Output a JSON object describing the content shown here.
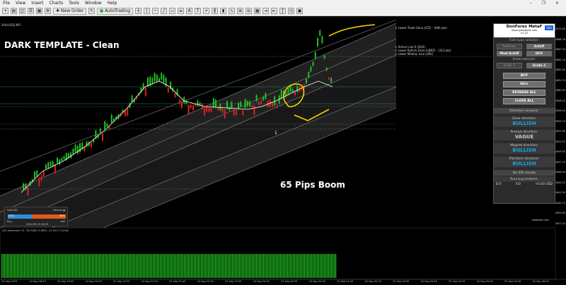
{
  "menu": [
    "File",
    "View",
    "Insert",
    "Charts",
    "Tools",
    "Window",
    "Help"
  ],
  "toolbar": {
    "new_order": "New Order",
    "autotrading": "AutoTrading"
  },
  "chart": {
    "symbol": "XAUUSD,M5",
    "title": "DARK TEMPLATE  - Clean",
    "annotation": "65 Pips Boom",
    "signal_label": "1",
    "watermark": "Doaks09.com"
  },
  "legend": [
    "< Lower Trade Zone (LTZ) - (846 pts)",
    "< Active Line 0 (ALD)",
    "< Lower Bullish Zone (LBBZ) - (313 pts)",
    "< Lower Median Line (LML)"
  ],
  "panel": {
    "brand": "DonForex MetaF",
    "url": "https://donforex.com",
    "version": "v1.22",
    "info": "Info",
    "fork_type_label": "Fork type selector:",
    "fork_types": [
      "Andrews",
      "Schiff",
      "Mod-Schiff",
      "DFX"
    ],
    "scale_label": "Scale selector:",
    "scales": [
      "Scale 1",
      "Scale 2"
    ],
    "actions": [
      "BUY",
      "SELL",
      "REVERSE ALL",
      "CLOSE ALL"
    ],
    "direction_title": "Direction analysis:",
    "zone_label": "Zone direction:",
    "zone_value": "BULLISH",
    "prompt_label": "Prompt direction:",
    "prompt_value": "VAGUE",
    "magnet_label": "Magnet direction:",
    "magnet_value": "BULLISH",
    "pitchfork_label": "Pitchfork direction:",
    "pitchfork_value": "BULLISH",
    "nearby": "No S/R nearby",
    "running_label": "Running trade(s):",
    "trade_b": "B:0",
    "trade_s": "S:0",
    "trade_pl": "+0.00 USD"
  },
  "mini_widget": {
    "symbol": "XAUUSD",
    "neutral": "Neutral ◆",
    "buy_pct": "42%",
    "sell_pct": "58%",
    "buy": "Buy",
    "sell": "Sell",
    "date": "2024.09.25 06:55"
  },
  "sentiment_label": "ATS Sentiment V2 -76.0168 23.9892 -52.0217 0.0000",
  "price_scale": [
    "2670.50",
    "2668.76",
    "2667.04",
    "2665.24",
    "2663.49",
    "2661.74",
    "2660.00",
    "2658.25",
    "2656.50",
    "2654.74",
    "2652.99",
    "2651.25",
    "2649.50",
    "2647.75",
    "2646.00",
    "2644.25",
    "2642.50",
    "2640.75",
    "2639.00",
    "2637.24"
  ],
  "time_axis": [
    "24 Sep 2024",
    "24 Sep 18:25",
    "24 Sep 19:05",
    "24 Sep 19:45",
    "24 Sep 20:25",
    "24 Sep 21:05",
    "24 Sep 21:45",
    "24 Sep 22:25",
    "24 Sep 23:05",
    "24 Sep 23:45",
    "25 Sep 00:25",
    "25 Sep 01:05",
    "25 Sep 01:45",
    "25 Sep 02:25",
    "25 Sep 03:05",
    "25 Sep 03:45",
    "25 Sep 04:25",
    "25 Sep 05:05",
    "25 Sep 05:45",
    "25 Sep 06:25"
  ],
  "colors": {
    "bull": "#22c422",
    "bear": "#e02020",
    "channel": "#9a9a9a",
    "annotation": "#f5d000",
    "bullish_text": "#1ba3e6"
  }
}
